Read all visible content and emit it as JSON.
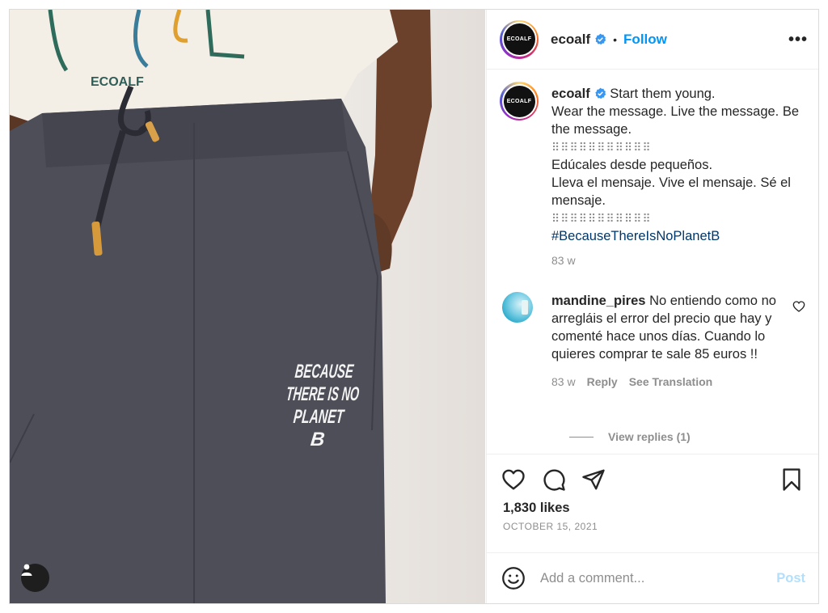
{
  "post": {
    "author": "ecoalf",
    "avatar_text": "ECOALF",
    "follow_label": "Follow",
    "separator": "•",
    "more_label": "•••"
  },
  "photo": {
    "shirt_text": "ECOALF",
    "print_lines": [
      "BECAUSE",
      "THERE IS NO",
      "PLANET",
      "B"
    ]
  },
  "caption": {
    "username": "ecoalf",
    "line1": "Start them young.",
    "line2": "Wear the message. Live the message. Be the message.",
    "divider": "⠿⠿⠿⠿⠿⠿⠿⠿⠿⠿⠿",
    "line3": "Edúcales desde pequeños.",
    "line4": "Lleva el mensaje. Vive el mensaje. Sé el mensaje.",
    "hashtag": "#BecauseThereIsNoPlanetB",
    "time": "83 w"
  },
  "comment": {
    "username": "mandine_pires",
    "text": "No entiendo como no arregláis el error del precio que hay y comenté hace unos días. Cuando lo quieres comprar te sale 85 euros !!",
    "time": "83 w",
    "reply_label": "Reply",
    "translate_label": "See Translation",
    "view_replies": "View replies (1)"
  },
  "stats": {
    "likes": "1,830 likes",
    "date": "OCTOBER 15, 2021"
  },
  "composer": {
    "placeholder": "Add a comment...",
    "post_label": "Post"
  },
  "colors": {
    "accent": "#0095f6",
    "hashtag": "#00376b",
    "muted": "#8e8e8e",
    "post_disabled": "#b2dffc"
  }
}
